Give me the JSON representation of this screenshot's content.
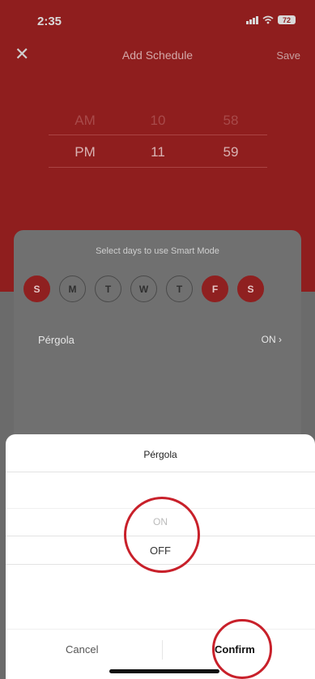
{
  "status_bar": {
    "time": "2:35",
    "battery": "72"
  },
  "nav": {
    "close_icon": "close-icon",
    "title": "Add Schedule",
    "save": "Save"
  },
  "picker": {
    "faint_row": [
      "",
      "",
      ""
    ],
    "mid_row": [
      "AM",
      "10",
      "58"
    ],
    "selected_row": [
      "PM",
      "11",
      "59"
    ]
  },
  "card": {
    "subtitle": "Select days to use Smart Mode",
    "days": [
      {
        "label": "S",
        "active": true
      },
      {
        "label": "M",
        "active": false
      },
      {
        "label": "T",
        "active": false
      },
      {
        "label": "W",
        "active": false
      },
      {
        "label": "T",
        "active": false
      },
      {
        "label": "F",
        "active": true
      },
      {
        "label": "S",
        "active": true
      }
    ],
    "device_label": "Pérgola",
    "device_value": "ON"
  },
  "sheet": {
    "title": "Pérgola",
    "options": [
      "ON",
      "OFF"
    ],
    "selected": "OFF",
    "cancel": "Cancel",
    "confirm": "Confirm"
  },
  "colors": {
    "brand_red": "#8f1e1e",
    "annotation_red": "#c8202a"
  }
}
